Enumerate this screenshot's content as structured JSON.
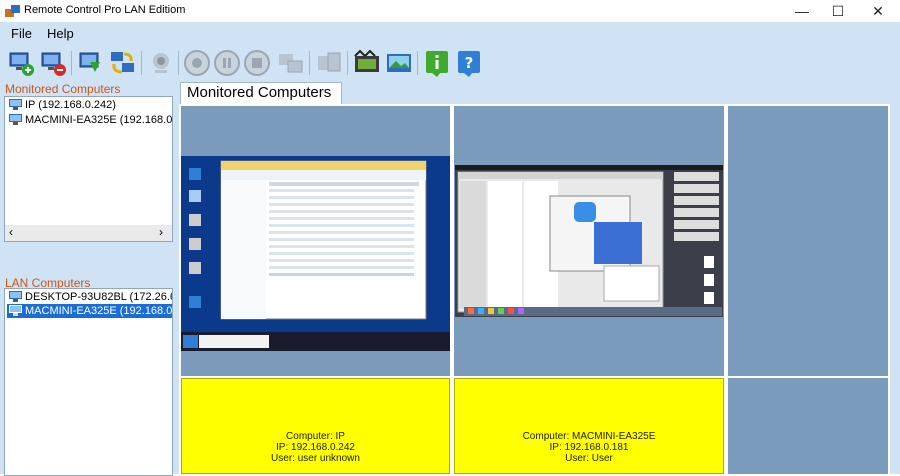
{
  "window": {
    "title": "Remote Control Pro LAN Editiom",
    "controls": [
      "—",
      "☐",
      "✕"
    ]
  },
  "menu": {
    "items": [
      "File",
      "Help"
    ]
  },
  "toolbar": {
    "buttons": [
      "add-computer",
      "remove-computer",
      "download",
      "refresh-group",
      "webcam",
      "record",
      "pause",
      "stop",
      "remote-control",
      "send-file",
      "screenshot",
      "gallery",
      "info",
      "help"
    ]
  },
  "sidebar": {
    "monitored_label": "Monitored Computers",
    "monitored_items": [
      "IP (192.168.0.242)",
      "MACMINI-EA325E (192.168.0."
    ],
    "lan_label": "LAN Computers",
    "lan_items": [
      "DESKTOP-93U82BL (172.26.6",
      "MACMINI-EA325E (192.168.0."
    ],
    "lan_selected": 1
  },
  "main": {
    "tab_label": "Monitored Computers",
    "cards": [
      {
        "line1": "Computer: IP",
        "line2": "IP: 192.168.0.242",
        "line3": "User: user unknown"
      },
      {
        "line1": "Computer: MACMINI-EA325E",
        "line2": "IP: 192.168.0.181",
        "line3": "User: User"
      }
    ]
  },
  "colors": {
    "chrome": "#cfe3f5",
    "cell_blue": "#7b9bbd",
    "offline_card": "#ffff00",
    "selection": "#1a6dd6",
    "section_label": "#c9561a"
  }
}
